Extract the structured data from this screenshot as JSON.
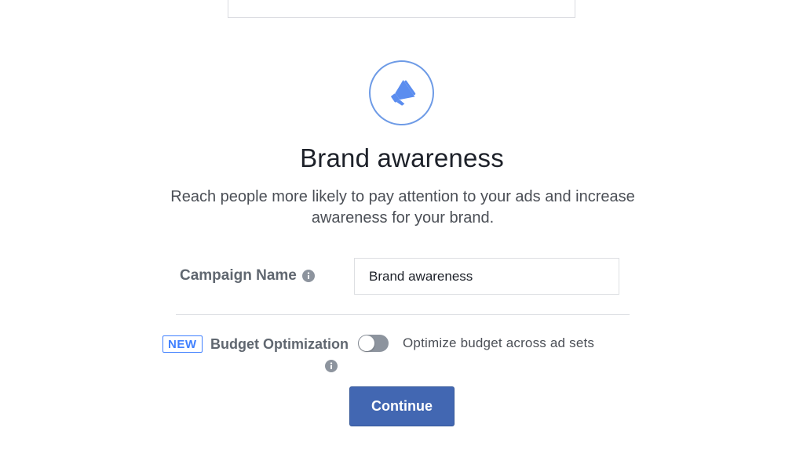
{
  "objective": {
    "icon": "megaphone-icon",
    "title": "Brand awareness",
    "description": "Reach people more likely to pay attention to your ads and increase awareness for your brand."
  },
  "campaign_name": {
    "label": "Campaign Name",
    "value": "Brand awareness"
  },
  "budget_optimization": {
    "badge": "NEW",
    "label": "Budget Optimization",
    "toggle_on": false,
    "toggle_text": "Optimize budget across ad sets"
  },
  "actions": {
    "continue_label": "Continue"
  },
  "colors": {
    "accent": "#4267b2",
    "icon_blue": "#5b8def",
    "badge_blue": "#4080ff",
    "toggle_off": "#8d949e"
  }
}
